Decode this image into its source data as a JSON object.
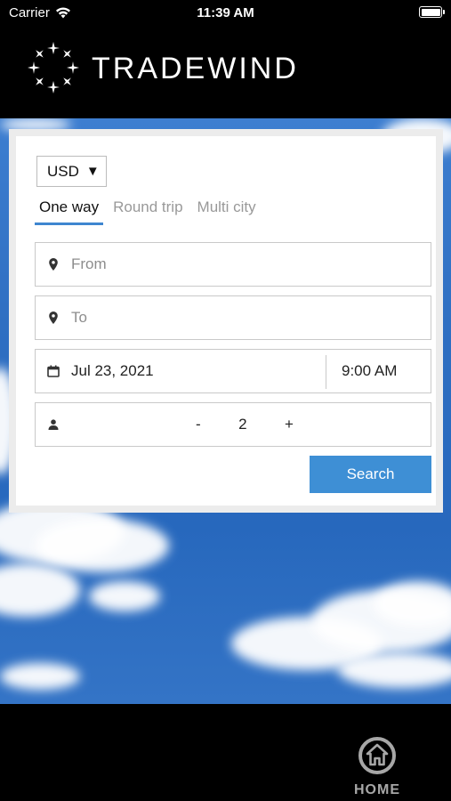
{
  "status": {
    "carrier": "Carrier",
    "time": "11:39 AM"
  },
  "brand": {
    "name": "TRADEWIND"
  },
  "form": {
    "currency": {
      "value": "USD",
      "caret": "▼"
    },
    "tabs": [
      {
        "label": "One way",
        "active": true
      },
      {
        "label": "Round trip",
        "active": false
      },
      {
        "label": "Multi city",
        "active": false
      }
    ],
    "from": {
      "placeholder": "From",
      "icon": "map-pin-icon"
    },
    "to": {
      "placeholder": "To",
      "icon": "map-pin-icon"
    },
    "date": {
      "value": "Jul 23, 2021",
      "time": "9:00 AM",
      "icon": "calendar-icon"
    },
    "passengers": {
      "icon": "person-icon",
      "minus": "-",
      "count": "2",
      "plus": "+"
    },
    "search_label": "Search"
  },
  "nav": {
    "home_label": "HOME",
    "home_icon": "home-icon"
  },
  "colors": {
    "accent": "#3e8fd5",
    "background": "#000000"
  }
}
